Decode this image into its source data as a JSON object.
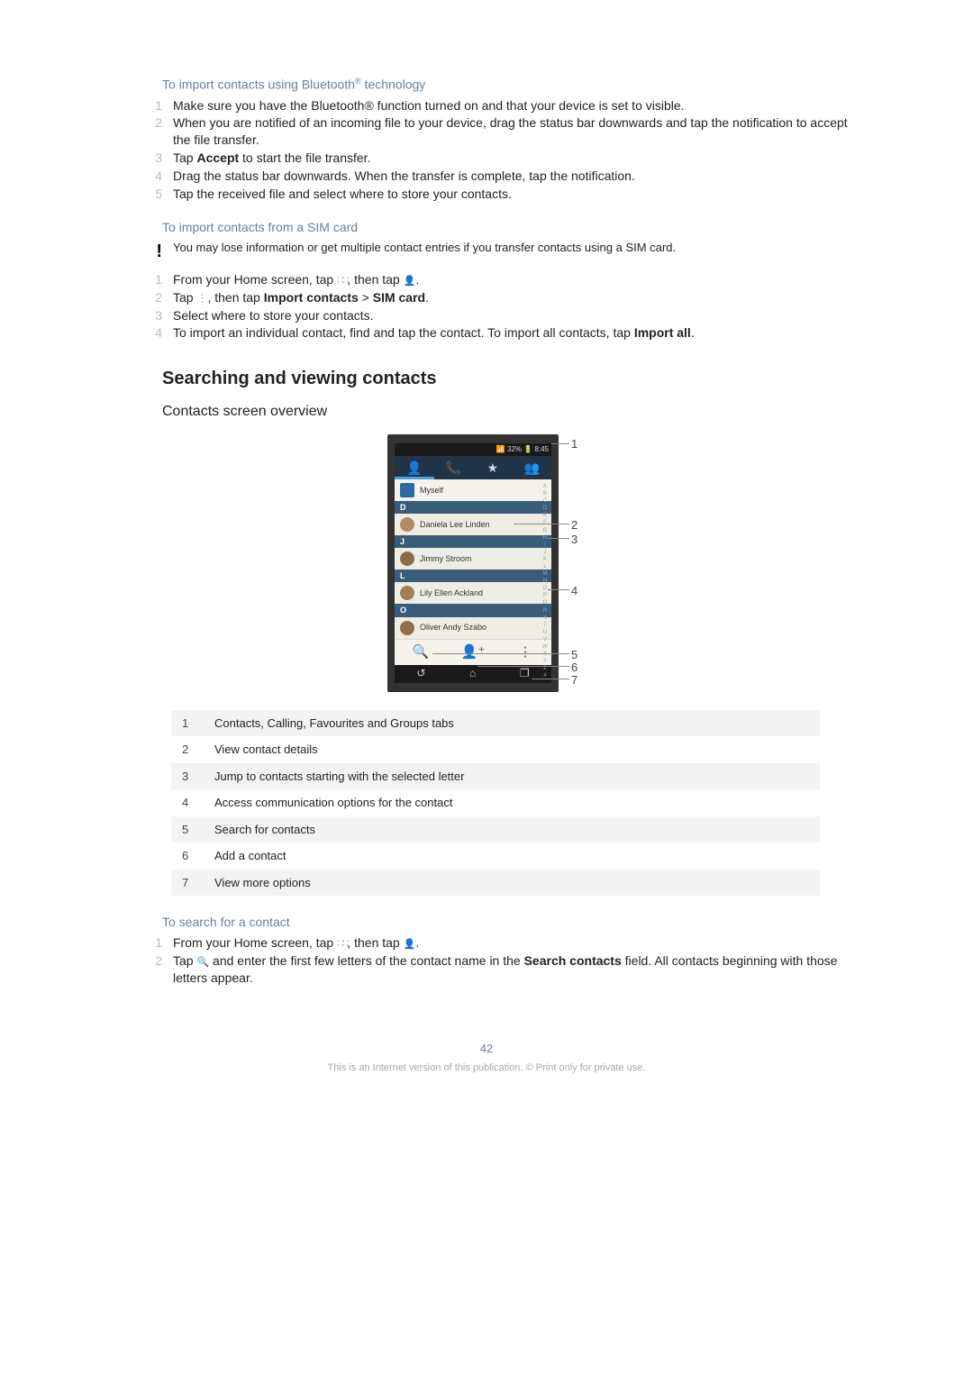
{
  "section1": {
    "heading_a": "To import contacts using Bluetooth",
    "heading_b": " technology",
    "reg": "®",
    "steps": [
      "Make sure you have the Bluetooth® function turned on and that your device is set to visible.",
      "When you are notified of an incoming file to your device, drag the status bar downwards and tap the notification to accept the file transfer.",
      "Tap Accept to start the file transfer.",
      "Drag the status bar downwards. When the transfer is complete, tap the notification.",
      "Tap the received file and select where to store your contacts."
    ],
    "step3_parts": {
      "pre": "Tap ",
      "bold": "Accept",
      "post": " to start the file transfer."
    }
  },
  "section2": {
    "heading": "To import contacts from a SIM card",
    "warning": "You may lose information or get multiple contact entries if you transfer contacts using a SIM card.",
    "s1": {
      "pre": "From your Home screen, tap ",
      "mid": ", then tap ",
      "post": "."
    },
    "s2": {
      "pre": "Tap ",
      "mid": ", then tap ",
      "b1": "Import contacts",
      "gt": " > ",
      "b2": "SIM card",
      "post": "."
    },
    "s3": "Select where to store your contacts.",
    "s4": {
      "pre": "To import an individual contact, find and tap the contact. To import all contacts, tap ",
      "b": "Import all",
      "post": "."
    }
  },
  "h2": "Searching and viewing contacts",
  "h3": "Contacts screen overview",
  "mock": {
    "status_signal": "📶 32% 🔋 8:45",
    "tabs": [
      "👤",
      "📞",
      "★",
      "👥"
    ],
    "me": "Myself",
    "letters": [
      "D",
      "J",
      "L",
      "O"
    ],
    "names": [
      "Daniela Lee Linden",
      "Jimmy Stroom",
      "Lily Ellen Ackland",
      "Oliver Andy Szabo"
    ],
    "alpha": [
      "A",
      "B",
      "C",
      "D",
      "E",
      "F",
      "G",
      "H",
      "I",
      "J",
      "K",
      "L",
      "M",
      "N",
      "O",
      "P",
      "Q",
      "R",
      "S",
      "T",
      "U",
      "V",
      "W",
      "X",
      "Y",
      "Z",
      "#"
    ],
    "bb": [
      "🔍",
      "👤⁺",
      "⋮"
    ],
    "nav": [
      "↺",
      "⌂",
      "❐"
    ]
  },
  "callouts": [
    "1",
    "2",
    "3",
    "4",
    "5",
    "6",
    "7"
  ],
  "legend": [
    {
      "n": "1",
      "t": "Contacts, Calling, Favourites and Groups tabs"
    },
    {
      "n": "2",
      "t": "View contact details"
    },
    {
      "n": "3",
      "t": "Jump to contacts starting with the selected letter"
    },
    {
      "n": "4",
      "t": "Access communication options for the contact"
    },
    {
      "n": "5",
      "t": "Search for contacts"
    },
    {
      "n": "6",
      "t": "Add a contact"
    },
    {
      "n": "7",
      "t": "View more options"
    }
  ],
  "section3": {
    "heading": "To search for a contact",
    "s1": {
      "pre": "From your Home screen, tap ",
      "mid": ", then tap ",
      "post": "."
    },
    "s2": {
      "pre": "Tap ",
      "mid": " and enter the first few letters of the contact name in the ",
      "b1": "Search contacts",
      "post2": " field. All contacts beginning with those letters appear."
    }
  },
  "page_number": "42",
  "footer": "This is an Internet version of this publication. © Print only for private use."
}
